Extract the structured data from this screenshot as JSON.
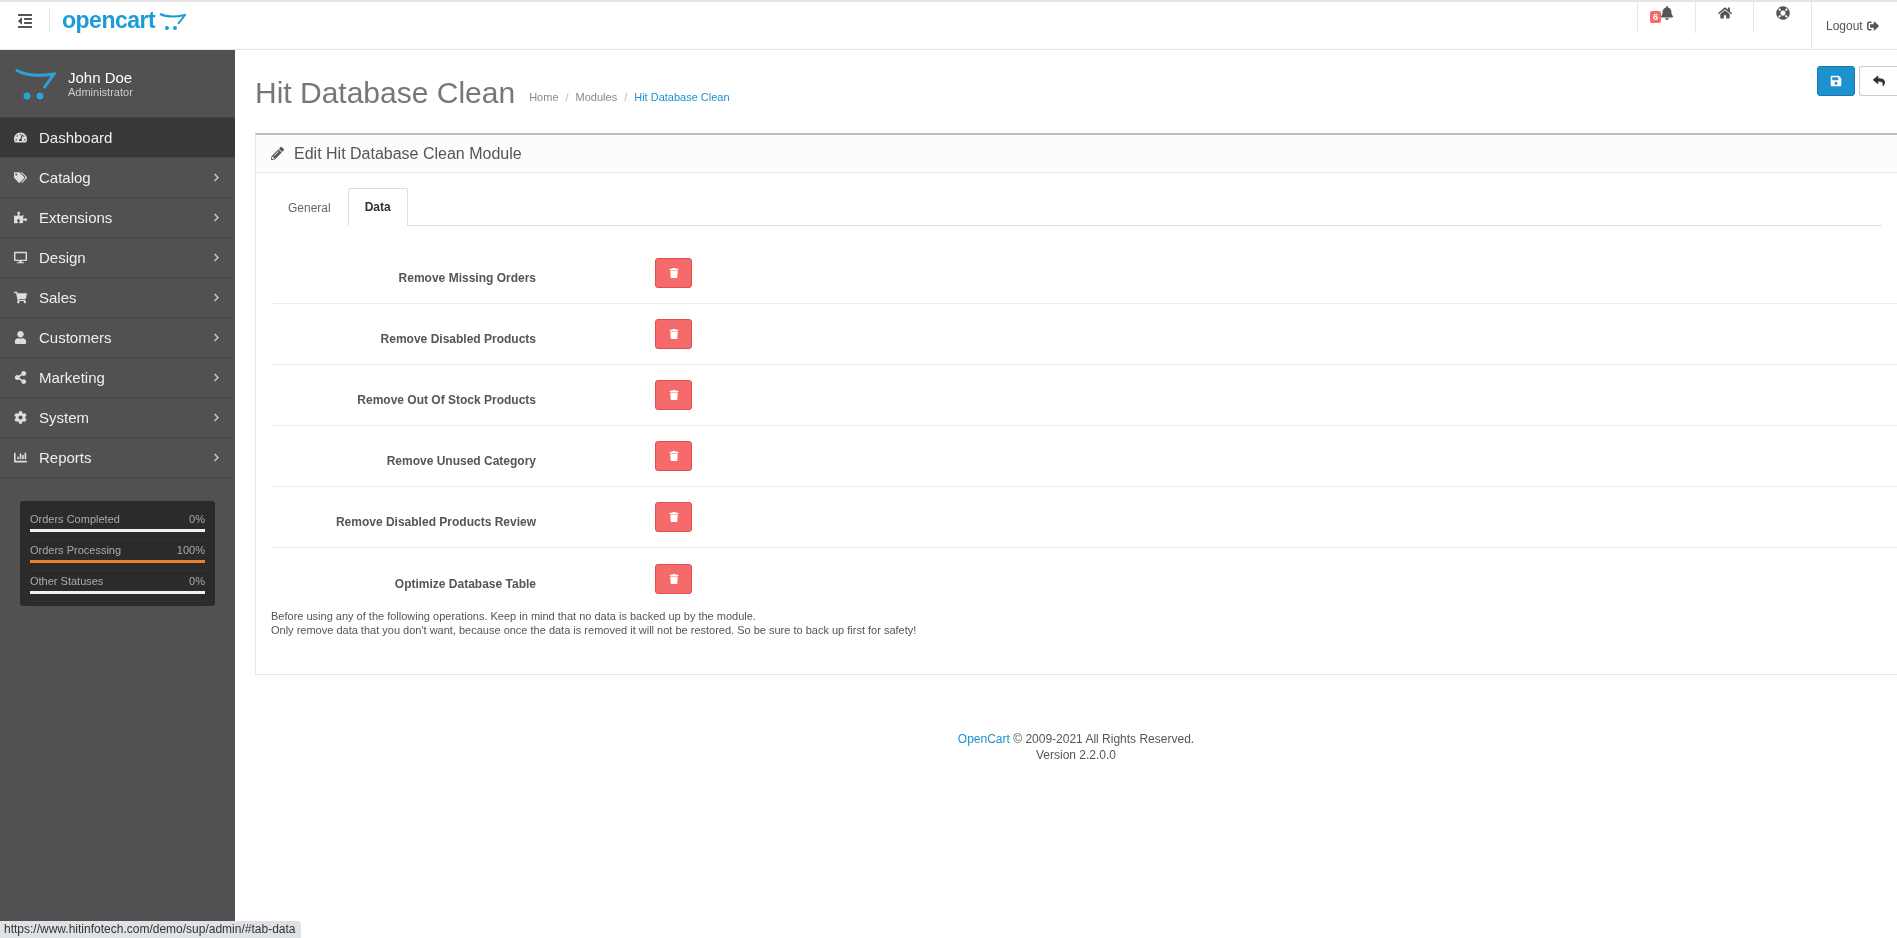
{
  "header": {
    "logo": "opencart",
    "notification_count": "6",
    "logout": "Logout"
  },
  "profile": {
    "name": "John Doe",
    "role": "Administrator"
  },
  "menu": [
    {
      "label": "Dashboard",
      "selected": true,
      "has_children": false
    },
    {
      "label": "Catalog",
      "selected": false,
      "has_children": true
    },
    {
      "label": "Extensions",
      "selected": false,
      "has_children": true
    },
    {
      "label": "Design",
      "selected": false,
      "has_children": true
    },
    {
      "label": "Sales",
      "selected": false,
      "has_children": true
    },
    {
      "label": "Customers",
      "selected": false,
      "has_children": true
    },
    {
      "label": "Marketing",
      "selected": false,
      "has_children": true
    },
    {
      "label": "System",
      "selected": false,
      "has_children": true
    },
    {
      "label": "Reports",
      "selected": false,
      "has_children": true
    }
  ],
  "stats": [
    {
      "label": "Orders Completed",
      "reading": "0%",
      "level": 0
    },
    {
      "label": "Orders Processing",
      "reading": "100%",
      "level": 1
    },
    {
      "label": "Other Statuses",
      "reading": "0%",
      "level": 0
    }
  ],
  "page": {
    "title": "Hit Database Clean",
    "breadcrumb_separator": "/",
    "breadcrumb": [
      {
        "label": "Home",
        "current": false
      },
      {
        "label": "Modules",
        "current": false
      },
      {
        "label": "Hit Database Clean",
        "current": true
      }
    ]
  },
  "panel": {
    "title": "Edit Hit Database Clean Module",
    "tabs": [
      {
        "label": "General",
        "selected": false
      },
      {
        "label": "Data",
        "selected": true
      }
    ],
    "actions": [
      "Remove Missing Orders",
      "Remove Disabled Products",
      "Remove Out Of Stock Products",
      "Remove Unused Category",
      "Remove Disabled Products Review",
      "Optimize Database Table"
    ],
    "notes": [
      "Before using any of the following operations. Keep in mind that no data is backed up by the module.",
      "Only remove data that you don't want, because once the data is removed it will not be restored. So be sure to back up first for safety!"
    ]
  },
  "footer": {
    "link": "OpenCart",
    "text": "© 2009-2021 All Rights Reserved.",
    "version": "Version 2.2.0.0"
  },
  "status_url": "https://www.hitinfotech.com/demo/sup/admin/#tab-data"
}
